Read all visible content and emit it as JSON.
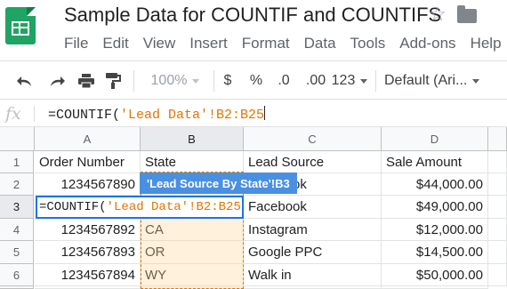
{
  "app": {
    "title": "Sample Data for COUNTIF and COUNTIFS",
    "star_glyph": "☆"
  },
  "menu": [
    "File",
    "Edit",
    "View",
    "Insert",
    "Format",
    "Data",
    "Tools",
    "Add-ons",
    "Help"
  ],
  "toolbar": {
    "zoom": "100%",
    "currency": "$",
    "percent": "%",
    "decrease_decimal": ".0",
    "increase_decimal": ".00",
    "more_formats": "123",
    "font": "Default (Ari..."
  },
  "formula_bar": {
    "fx": "fx",
    "prefix": "=COUNTIF(",
    "reference": "'Lead Data'!B2:B25"
  },
  "grid": {
    "columns": [
      "A",
      "B",
      "C",
      "D"
    ],
    "rows": [
      "1",
      "2",
      "3",
      "4",
      "5",
      "6",
      "7"
    ],
    "headers": [
      "Order Number",
      "State",
      "Lead Source",
      "Sale Amount"
    ],
    "data": [
      [
        "1234567890",
        "",
        "Facebook",
        "$44,000.00"
      ],
      [
        "",
        "",
        "Facebook",
        "$49,000.00"
      ],
      [
        "1234567892",
        "CA",
        "Instagram",
        "$12,000.00"
      ],
      [
        "1234567893",
        "OR",
        "Google PPC",
        "$14,500.00"
      ],
      [
        "1234567894",
        "WY",
        "Walk in",
        "$50,000.00"
      ],
      [
        "",
        "",
        "",
        ""
      ]
    ],
    "active_cell": {
      "prefix": "=COUNTIF(",
      "reference": "'Lead Data'!B2:B25"
    },
    "tooltip": "'Lead Source By State'!B3"
  },
  "colors": {
    "accent": "#1a73e8",
    "reference": "#e37400",
    "logo": "#1fa463",
    "tooltip": "#4a90e2"
  },
  "icons": [
    "sheets-logo-icon",
    "star-icon",
    "folder-icon",
    "undo-icon",
    "redo-icon",
    "print-icon",
    "paint-format-icon",
    "caret-down-icon",
    "fx-icon"
  ]
}
